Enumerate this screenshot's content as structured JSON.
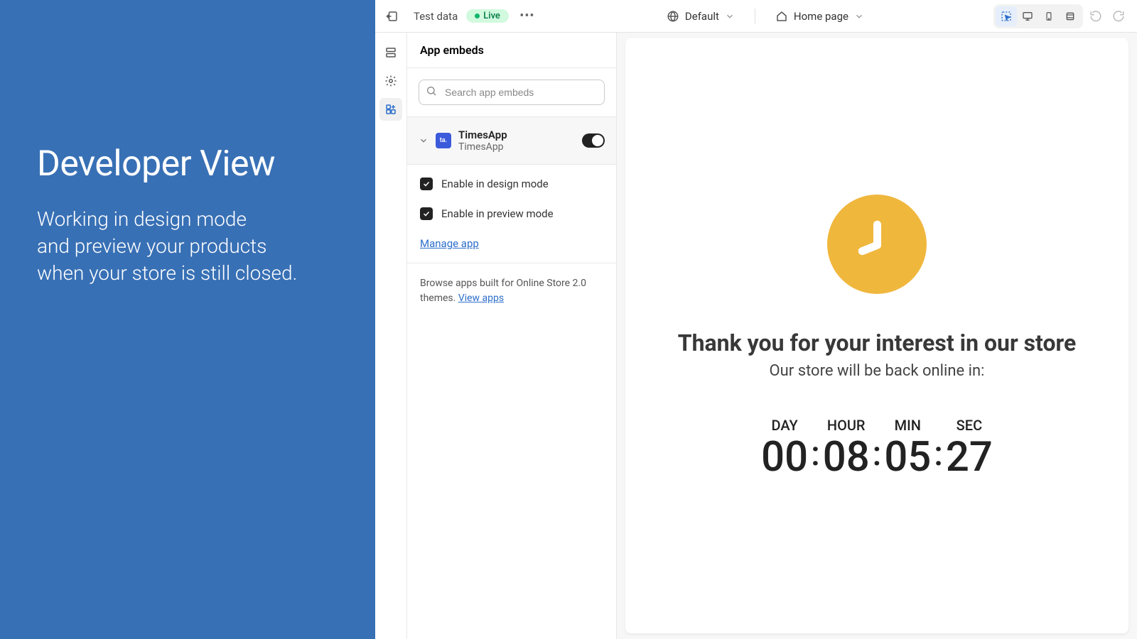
{
  "left_panel": {
    "title": "Developer View",
    "subtitle_line1": "Working in design mode",
    "subtitle_line2": "and preview your products",
    "subtitle_line3": "when your store is still closed."
  },
  "top_bar": {
    "test_data": "Test data",
    "live_badge": "Live",
    "default_selector": "Default",
    "page_selector": "Home page"
  },
  "settings": {
    "header": "App embeds",
    "search_placeholder": "Search app embeds",
    "app": {
      "name": "TimesApp",
      "subtitle": "TimesApp",
      "icon_text": "ta."
    },
    "checkbox_design": "Enable in design mode",
    "checkbox_preview": "Enable in preview mode",
    "manage_link": "Manage app",
    "browse_text": "Browse apps built for Online Store 2.0 themes. ",
    "browse_link": "View apps"
  },
  "preview": {
    "title": "Thank you for your interest in our store",
    "subtitle": "Our store will be back online in:",
    "countdown": {
      "day_label": "DAY",
      "day_value": "00",
      "hour_label": "HOUR",
      "hour_value": "08",
      "min_label": "MIN",
      "min_value": "05",
      "sec_label": "SEC",
      "sec_value": "27"
    }
  }
}
